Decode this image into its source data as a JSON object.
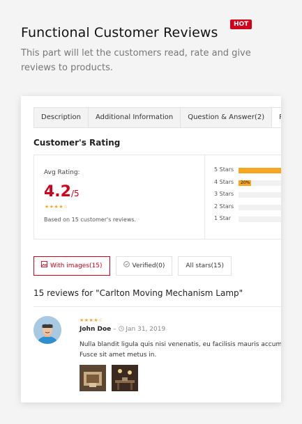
{
  "hero": {
    "title": "Functional Customer Reviews",
    "badge": "HOT",
    "subtitle": "This part will let the customers read, rate and give reviews to products."
  },
  "tabs": [
    "Description",
    "Additional Information",
    "Question & Answer(2)",
    "Rev"
  ],
  "rating": {
    "section_title": "Customer's Rating",
    "avg_label": "Avg Rating:",
    "avg_value": "4.2",
    "avg_max": "/5",
    "avg_stars": 4,
    "based_on": "Based on 15 customer's reviews.",
    "breakdown": [
      {
        "label": "5 Stars",
        "fraction": 0.8,
        "pct_text": ""
      },
      {
        "label": "4 Stars",
        "fraction": 0.2,
        "pct_text": "20%"
      },
      {
        "label": "3 Stars",
        "fraction": 0,
        "pct_text": ""
      },
      {
        "label": "2 Stars",
        "fraction": 0,
        "pct_text": ""
      },
      {
        "label": "1 Star",
        "fraction": 0,
        "pct_text": ""
      }
    ]
  },
  "filters": {
    "with_images": "With images(15)",
    "verified": "Verified(0)",
    "all_stars": "All stars(15)"
  },
  "reviews": {
    "title": "15 reviews for \"Carlton Moving Mechanism Lamp\"",
    "items": [
      {
        "stars": 4,
        "author": "John Doe",
        "separator": "–",
        "date": "Jan 31, 2019",
        "body_line1": "Nulla blandit ligula quis nisi venenatis, eu facilisis mauris accumsan.",
        "body_line2": "Fusce sit amet metus in."
      }
    ]
  },
  "colors": {
    "accent": "#d0021b",
    "star": "#f5a623",
    "bar": "#f5a623"
  },
  "icons": {
    "image_filter": "image-icon",
    "verified_filter": "check-circle-icon",
    "date": "clock-icon"
  }
}
